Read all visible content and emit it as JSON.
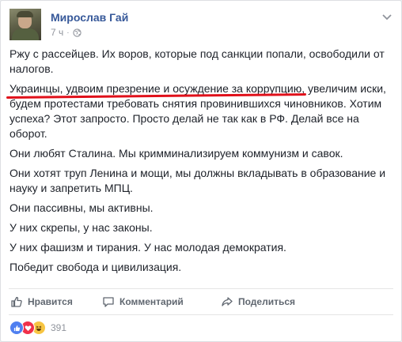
{
  "post": {
    "author": "Мирослав Гай",
    "time": "7 ч",
    "separator": "·",
    "icons": {
      "avatar": "profile-photo",
      "privacy": "globe-icon",
      "menu": "chevron-down-icon"
    },
    "paragraphs": {
      "p1": "Ржу с рассейцев. Их воров, которые под санкции попали, освободили от налогов.",
      "p2_underlined": "Украинцы, удвоим презрение и осуждение за коррупцию",
      "p2_rest": ", увеличим иски, будем протестами требовать снятия провинившихся чиновников. Хотим успеха? Этот запросто. Просто делай не так как в РФ. Делай все на оборот.",
      "p3": "Они любят Сталина. Мы кримминализируем коммунизм и савок.",
      "p4": "Они хотят труп Ленина и мощи, мы должны вкладывать в образование и науку и запретить МПЦ.",
      "p5": "Они пассивны, мы активны.",
      "p6": "У них скрепы, у нас законы.",
      "p7": "У них фашизм и тирания. У нас молодая демократия.",
      "p8": "Победит свобода и цивилизация."
    },
    "underline_color": "#e0101a"
  },
  "actions": {
    "like": "Нравится",
    "comment": "Комментарий",
    "share": "Поделиться"
  },
  "reactions": {
    "types": [
      "like",
      "love",
      "haha"
    ],
    "count": "391"
  },
  "colors": {
    "author": "#365899",
    "meta": "#90949c",
    "text": "#1d2129",
    "action": "#606770"
  }
}
